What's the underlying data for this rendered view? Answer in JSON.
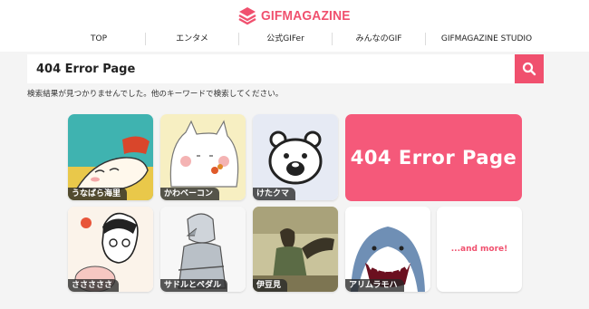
{
  "header": {
    "logo_text": "GIFMAGAZINE",
    "brand_color": "#f0506e"
  },
  "nav": {
    "items": [
      "TOP",
      "エンタメ",
      "公式GIFer",
      "みんなのGIF",
      "GIFMAGAZINE STUDIO"
    ]
  },
  "search": {
    "value": "404 Error Page",
    "button_icon": "search-icon"
  },
  "message": "検索結果が見つかりませんでした。他のキーワードで検索してください。",
  "cards": [
    {
      "label": "うなばら海里"
    },
    {
      "label": "かわベーコン"
    },
    {
      "label": "けたクマ"
    },
    {
      "label": "さささささ"
    },
    {
      "label": "サドルとペダル"
    },
    {
      "label": "伊豆見"
    },
    {
      "label": "アリムラモハ"
    }
  ],
  "big_card": {
    "text": "404 Error Page"
  },
  "more_card": {
    "text": "...and more!"
  }
}
